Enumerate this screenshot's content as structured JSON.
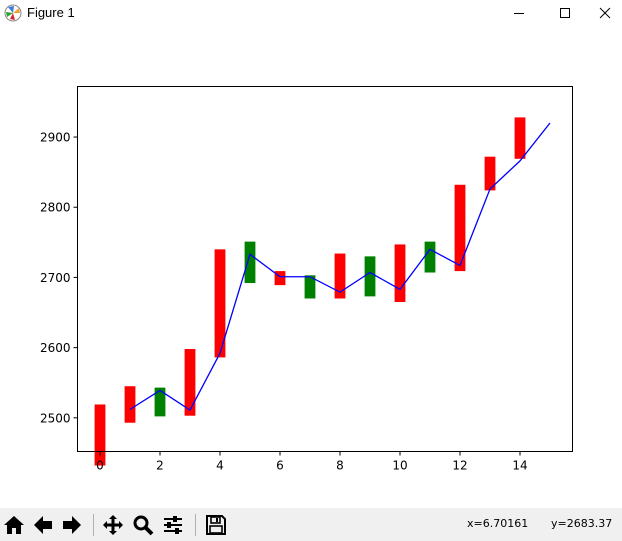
{
  "window": {
    "title": "Figure 1",
    "icons": [
      "matplotlib-icon",
      "minimize-icon",
      "maximize-icon",
      "close-icon"
    ]
  },
  "toolbar": {
    "icons": [
      "home-icon",
      "back-arrow-icon",
      "forward-arrow-icon",
      "pan-icon",
      "zoom-icon",
      "subplots-config-icon",
      "save-icon"
    ],
    "coord_x": "x=6.70161",
    "coord_y": "y=2683.37"
  },
  "chart_data": {
    "type": "candlestick",
    "title": "",
    "xlabel": "",
    "ylabel": "",
    "xlim": [
      -0.75,
      15.75
    ],
    "ylim": [
      2452,
      2972
    ],
    "xticks": [
      0,
      2,
      4,
      6,
      8,
      10,
      12,
      14
    ],
    "yticks": [
      2500,
      2600,
      2700,
      2800,
      2900
    ],
    "grid": false,
    "colors": {
      "up": "#ff0000",
      "down": "#008000",
      "line": "#0000ff"
    },
    "candles": [
      {
        "x": 0,
        "open": 2432,
        "close": 2519
      },
      {
        "x": 1,
        "open": 2493,
        "close": 2545
      },
      {
        "x": 2,
        "open": 2543,
        "close": 2502
      },
      {
        "x": 3,
        "open": 2503,
        "close": 2598
      },
      {
        "x": 4,
        "open": 2586,
        "close": 2740
      },
      {
        "x": 5,
        "open": 2751,
        "close": 2692
      },
      {
        "x": 6,
        "open": 2689,
        "close": 2709
      },
      {
        "x": 7,
        "open": 2703,
        "close": 2670
      },
      {
        "x": 8,
        "open": 2670,
        "close": 2734
      },
      {
        "x": 9,
        "open": 2730,
        "close": 2673
      },
      {
        "x": 10,
        "open": 2665,
        "close": 2747
      },
      {
        "x": 11,
        "open": 2751,
        "close": 2707
      },
      {
        "x": 12,
        "open": 2709,
        "close": 2832
      },
      {
        "x": 13,
        "open": 2824,
        "close": 2872
      },
      {
        "x": 14,
        "open": 2869,
        "close": 2928
      }
    ],
    "line": {
      "x": [
        1,
        2,
        3,
        4,
        5,
        6,
        7,
        8,
        9,
        10,
        11,
        12,
        13,
        14,
        15
      ],
      "y": [
        2512,
        2539,
        2511,
        2592,
        2733,
        2701,
        2701,
        2679,
        2707,
        2683,
        2740,
        2717,
        2826,
        2866,
        2920
      ]
    }
  }
}
